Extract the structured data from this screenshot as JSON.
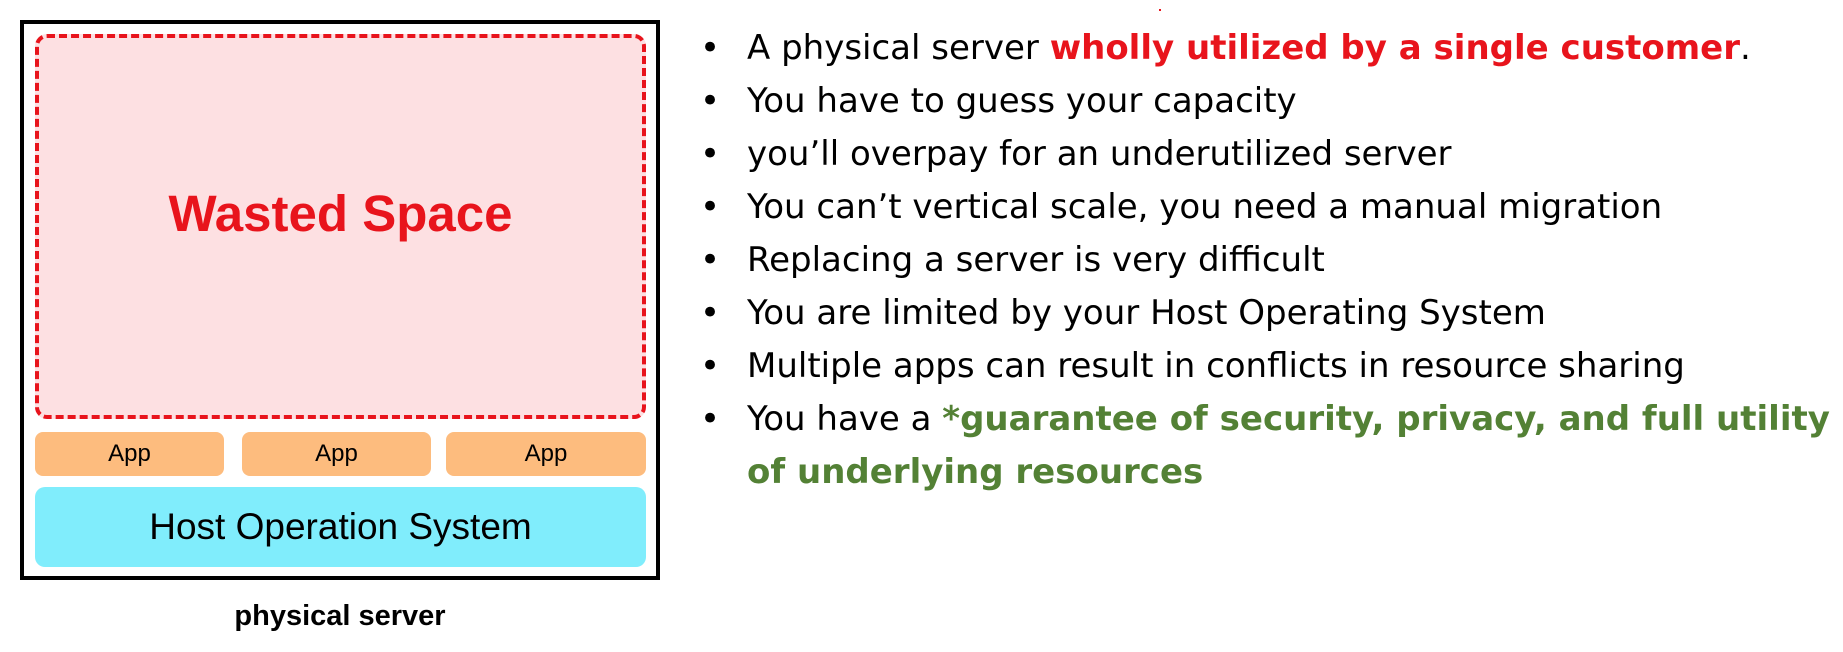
{
  "diagram": {
    "wasted_label": "Wasted Space",
    "apps": [
      "App",
      "App",
      "App"
    ],
    "host_os_label": "Host Operation System",
    "caption": "physical server"
  },
  "bullets": [
    {
      "before": "A physical server ",
      "highlight": "wholly utilized by a single customer",
      "after": "."
    },
    {
      "before": "You have to guess your capacity",
      "highlight": "",
      "after": ""
    },
    {
      "before": "you’ll overpay for an underutilized server",
      "highlight": "",
      "after": ""
    },
    {
      "before": "You can’t vertical scale, you need a manual migration",
      "highlight": "",
      "after": ""
    },
    {
      "before": "Replacing a server is very difficult",
      "highlight": "",
      "after": ""
    },
    {
      "before": "You are limited by your Host Operating System",
      "highlight": "",
      "after": ""
    },
    {
      "before": "Multiple apps can result in conflicts in resource sharing",
      "highlight": "",
      "after": ""
    },
    {
      "before": "You have a ",
      "highlight": "*guarantee of security, privacy, and full utility of underlying resources",
      "after": ""
    }
  ],
  "colors": {
    "wasted_fill": "#fde0e2",
    "wasted_border": "#e8141c",
    "app_fill": "#fdbc7e",
    "host_fill": "#80edfc",
    "red_highlight": "#e8141c",
    "green_highlight": "#538135"
  }
}
